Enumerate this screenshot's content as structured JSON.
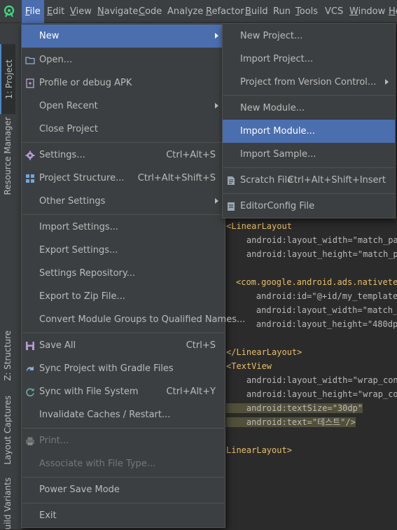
{
  "menubar": {
    "items": [
      {
        "label": "File",
        "mn": "F",
        "rest": "ile"
      },
      {
        "label": "Edit",
        "mn": "E",
        "rest": "dit"
      },
      {
        "label": "View",
        "mn": "V",
        "rest": "iew"
      },
      {
        "label": "Navigate",
        "mn": "N",
        "rest": "avigate"
      },
      {
        "label": "Code",
        "mn": "C",
        "rest": "ode"
      },
      {
        "label": "Analyze",
        "mn": "",
        "rest": "Analyze"
      },
      {
        "label": "Refactor",
        "mn": "R",
        "rest": "efactor"
      },
      {
        "label": "Build",
        "mn": "B",
        "rest": "uild"
      },
      {
        "label": "Run",
        "mn": "",
        "rest": "Run"
      },
      {
        "label": "Tools",
        "mn": "T",
        "rest": "ools"
      },
      {
        "label": "VCS",
        "mn": "",
        "rest": "VCS"
      },
      {
        "label": "Window",
        "mn": "W",
        "rest": "indow"
      },
      {
        "label": "He",
        "mn": "H",
        "rest": "e"
      }
    ]
  },
  "toolstrip": {
    "project_tab": "1: Project",
    "resource_manager": "Resource Manager",
    "structure_tab": "Z: Structure",
    "layout_captures": "Layout Captures",
    "build_variants": "uild Variants"
  },
  "file_menu": {
    "items": [
      {
        "label": "New",
        "has_submenu": true
      },
      {
        "label": "Open...",
        "icon": "folder-icon"
      },
      {
        "label": "Profile or debug APK",
        "icon": "apk-icon"
      },
      {
        "label": "Open Recent",
        "has_submenu": true
      },
      {
        "label": "Close Project"
      },
      {
        "label": "Settings...",
        "shortcut": "Ctrl+Alt+S",
        "icon": "gear-icon"
      },
      {
        "label": "Project Structure...",
        "shortcut": "Ctrl+Alt+Shift+S",
        "icon": "project-structure-icon"
      },
      {
        "label": "Other Settings",
        "has_submenu": true
      },
      {
        "label": "Import Settings..."
      },
      {
        "label": "Export Settings..."
      },
      {
        "label": "Settings Repository..."
      },
      {
        "label": "Export to Zip File..."
      },
      {
        "label": "Convert Module Groups to Qualified Names..."
      },
      {
        "label": "Save All",
        "shortcut": "Ctrl+S",
        "icon": "save-icon"
      },
      {
        "label": "Sync Project with Gradle Files",
        "icon": "gradle-sync-icon"
      },
      {
        "label": "Sync with File System",
        "shortcut": "Ctrl+Alt+Y",
        "icon": "refresh-icon"
      },
      {
        "label": "Invalidate Caches / Restart..."
      },
      {
        "label": "Print...",
        "icon": "print-icon",
        "disabled": true
      },
      {
        "label": "Associate with File Type...",
        "disabled": true
      },
      {
        "label": "Power Save Mode"
      },
      {
        "label": "Exit"
      }
    ]
  },
  "new_submenu": {
    "items": [
      {
        "label": "New Project..."
      },
      {
        "label": "Import Project..."
      },
      {
        "label": "Project from Version Control...",
        "has_submenu": true
      },
      {
        "label": "New Module..."
      },
      {
        "label": "Import Module..."
      },
      {
        "label": "Import Sample..."
      },
      {
        "label": "Scratch File",
        "shortcut": "Ctrl+Alt+Shift+Insert",
        "icon": "scratch-file-icon"
      },
      {
        "label": "EditorConfig File",
        "icon": "editorconfig-icon"
      }
    ]
  },
  "code_lines": [
    "<LinearLayout",
    "    android:layout_width=\"match_pa",
    "    android:layout_height=\"match_pa",
    "<com.google.android.ads.nativetem",
    "    android:id=\"@+id/my_template\"",
    "    android:layout_width=\"match_p",
    "    android:layout_height=\"480dp\"",
    "</LinearLayout>",
    "<TextView",
    "    android:layout_width=\"wrap_cont",
    "    android:layout_height=\"wrap_con",
    "    android:textSize=\"30dp\"",
    "    android:text=\"테스트\"/>",
    "LinearLayout>"
  ],
  "colors": {
    "menu_bg": "#3c3f41",
    "selection": "#4b6eaf",
    "hover": "#4b6eaf",
    "editor_bg": "#2b2b2b",
    "xml_tag": "#e8bf6a",
    "xml_namespace": "#9876aa",
    "xml_value": "#6a8759"
  }
}
